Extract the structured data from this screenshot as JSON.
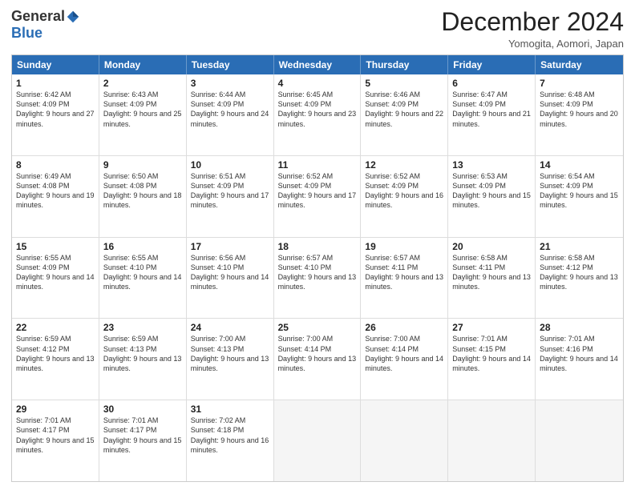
{
  "header": {
    "logo_general": "General",
    "logo_blue": "Blue",
    "month_title": "December 2024",
    "location": "Yomogita, Aomori, Japan"
  },
  "days_of_week": [
    "Sunday",
    "Monday",
    "Tuesday",
    "Wednesday",
    "Thursday",
    "Friday",
    "Saturday"
  ],
  "weeks": [
    [
      {
        "day": "1",
        "sunrise": "6:42 AM",
        "sunset": "4:09 PM",
        "daylight": "9 hours and 27 minutes."
      },
      {
        "day": "2",
        "sunrise": "6:43 AM",
        "sunset": "4:09 PM",
        "daylight": "9 hours and 25 minutes."
      },
      {
        "day": "3",
        "sunrise": "6:44 AM",
        "sunset": "4:09 PM",
        "daylight": "9 hours and 24 minutes."
      },
      {
        "day": "4",
        "sunrise": "6:45 AM",
        "sunset": "4:09 PM",
        "daylight": "9 hours and 23 minutes."
      },
      {
        "day": "5",
        "sunrise": "6:46 AM",
        "sunset": "4:09 PM",
        "daylight": "9 hours and 22 minutes."
      },
      {
        "day": "6",
        "sunrise": "6:47 AM",
        "sunset": "4:09 PM",
        "daylight": "9 hours and 21 minutes."
      },
      {
        "day": "7",
        "sunrise": "6:48 AM",
        "sunset": "4:09 PM",
        "daylight": "9 hours and 20 minutes."
      }
    ],
    [
      {
        "day": "8",
        "sunrise": "6:49 AM",
        "sunset": "4:08 PM",
        "daylight": "9 hours and 19 minutes."
      },
      {
        "day": "9",
        "sunrise": "6:50 AM",
        "sunset": "4:08 PM",
        "daylight": "9 hours and 18 minutes."
      },
      {
        "day": "10",
        "sunrise": "6:51 AM",
        "sunset": "4:09 PM",
        "daylight": "9 hours and 17 minutes."
      },
      {
        "day": "11",
        "sunrise": "6:52 AM",
        "sunset": "4:09 PM",
        "daylight": "9 hours and 17 minutes."
      },
      {
        "day": "12",
        "sunrise": "6:52 AM",
        "sunset": "4:09 PM",
        "daylight": "9 hours and 16 minutes."
      },
      {
        "day": "13",
        "sunrise": "6:53 AM",
        "sunset": "4:09 PM",
        "daylight": "9 hours and 15 minutes."
      },
      {
        "day": "14",
        "sunrise": "6:54 AM",
        "sunset": "4:09 PM",
        "daylight": "9 hours and 15 minutes."
      }
    ],
    [
      {
        "day": "15",
        "sunrise": "6:55 AM",
        "sunset": "4:09 PM",
        "daylight": "9 hours and 14 minutes."
      },
      {
        "day": "16",
        "sunrise": "6:55 AM",
        "sunset": "4:10 PM",
        "daylight": "9 hours and 14 minutes."
      },
      {
        "day": "17",
        "sunrise": "6:56 AM",
        "sunset": "4:10 PM",
        "daylight": "9 hours and 14 minutes."
      },
      {
        "day": "18",
        "sunrise": "6:57 AM",
        "sunset": "4:10 PM",
        "daylight": "9 hours and 13 minutes."
      },
      {
        "day": "19",
        "sunrise": "6:57 AM",
        "sunset": "4:11 PM",
        "daylight": "9 hours and 13 minutes."
      },
      {
        "day": "20",
        "sunrise": "6:58 AM",
        "sunset": "4:11 PM",
        "daylight": "9 hours and 13 minutes."
      },
      {
        "day": "21",
        "sunrise": "6:58 AM",
        "sunset": "4:12 PM",
        "daylight": "9 hours and 13 minutes."
      }
    ],
    [
      {
        "day": "22",
        "sunrise": "6:59 AM",
        "sunset": "4:12 PM",
        "daylight": "9 hours and 13 minutes."
      },
      {
        "day": "23",
        "sunrise": "6:59 AM",
        "sunset": "4:13 PM",
        "daylight": "9 hours and 13 minutes."
      },
      {
        "day": "24",
        "sunrise": "7:00 AM",
        "sunset": "4:13 PM",
        "daylight": "9 hours and 13 minutes."
      },
      {
        "day": "25",
        "sunrise": "7:00 AM",
        "sunset": "4:14 PM",
        "daylight": "9 hours and 13 minutes."
      },
      {
        "day": "26",
        "sunrise": "7:00 AM",
        "sunset": "4:14 PM",
        "daylight": "9 hours and 14 minutes."
      },
      {
        "day": "27",
        "sunrise": "7:01 AM",
        "sunset": "4:15 PM",
        "daylight": "9 hours and 14 minutes."
      },
      {
        "day": "28",
        "sunrise": "7:01 AM",
        "sunset": "4:16 PM",
        "daylight": "9 hours and 14 minutes."
      }
    ],
    [
      {
        "day": "29",
        "sunrise": "7:01 AM",
        "sunset": "4:17 PM",
        "daylight": "9 hours and 15 minutes."
      },
      {
        "day": "30",
        "sunrise": "7:01 AM",
        "sunset": "4:17 PM",
        "daylight": "9 hours and 15 minutes."
      },
      {
        "day": "31",
        "sunrise": "7:02 AM",
        "sunset": "4:18 PM",
        "daylight": "9 hours and 16 minutes."
      },
      null,
      null,
      null,
      null
    ]
  ]
}
